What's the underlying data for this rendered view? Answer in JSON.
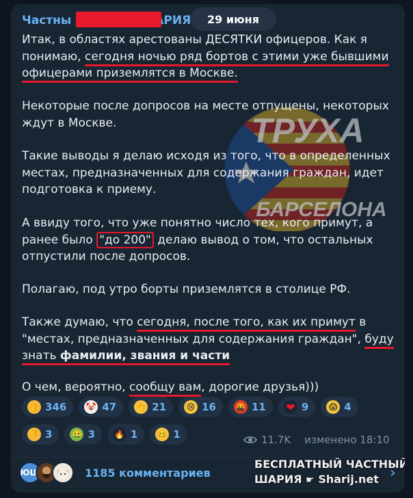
{
  "header": {
    "channel_name_visible": "Частны",
    "channel_name_suffix": "АРИЯ",
    "date": "29 июня"
  },
  "post": {
    "p1_a": "Итак, в областях арестованы ДЕСЯТКИ офицеров. Как я понимаю, ",
    "p1_u": "сегодня ночью ряд бортов с этими уже бывшими офицерами приземлятся в Москве.",
    "p2": "Некоторые после допросов на месте отпущены, некоторых ждут в Москве.",
    "p3": "Такие выводы я делаю исходя из того, что в определенных местах, предназначенных для содержания граждан, идет подготовка к приему.",
    "p4_a": "А ввиду того, что уже понятно число тех, кого примут, а ранее было ",
    "p4_box": "\"до 200\"",
    "p4_b": " делаю вывод о том, что  остальных отпустили после допросов.",
    "p5": "Полагаю, под утро борты приземлятся в столице РФ.",
    "p6_a": "Также думаю, что ",
    "p6_u1": "сегодня, после того, как их примут",
    "p6_b": " в \"местах, предназначенных для содержания граждан\", ",
    "p6_u2a": "буду знать ",
    "p6_u2b": "фамилии, звания и части",
    "p7_a": "О чем, вероятно, ",
    "p7_u": "сообщу вам",
    "p7_b": ", дорогие друзья)))"
  },
  "watermark": {
    "line1": "ТРУХА",
    "line2": "БАРСЕЛОНА"
  },
  "reactions": [
    {
      "icon": "thumbs-up-icon",
      "glyph": "👍",
      "color": "#f5b93a",
      "count": "346"
    },
    {
      "icon": "clown-icon",
      "glyph": "🤡",
      "color": "#f2f2f2",
      "count": "47"
    },
    {
      "icon": "clap-icon",
      "glyph": "👏",
      "color": "#f5c341",
      "count": "21"
    },
    {
      "icon": "crying-face-icon",
      "glyph": "😢",
      "color": "#f5c341",
      "count": "16"
    },
    {
      "icon": "cursing-face-icon",
      "glyph": "🤬",
      "color": "#d9412b",
      "count": "11"
    },
    {
      "icon": "red-heart-icon",
      "glyph": "❤",
      "color": "#182533",
      "count": "9"
    },
    {
      "icon": "screaming-face-icon",
      "glyph": "😱",
      "color": "#f5c341",
      "count": "4"
    },
    {
      "icon": "thumbs-down-icon",
      "glyph": "👎",
      "color": "#f5b93a",
      "count": "3"
    },
    {
      "icon": "vomiting-face-icon",
      "glyph": "🤮",
      "color": "#7ab84a",
      "count": "3"
    },
    {
      "icon": "fire-icon",
      "glyph": "🔥",
      "color": "#182533",
      "count": "1"
    },
    {
      "icon": "woozy-face-icon",
      "glyph": "🥴",
      "color": "#f5c341",
      "count": "1"
    }
  ],
  "meta": {
    "views": "11.7K",
    "edited": "изменено 18:10"
  },
  "comments": {
    "avatar1_text": "ЮШ",
    "avatar1_color": "#4a90d9",
    "label": "1185 комментариев"
  },
  "brand": {
    "line1": "БЕСПЛАТНЫЙ ЧАСТНЫЙ",
    "line2_a": "ШАРИЯ",
    "line2_b": "Sharij.net"
  }
}
